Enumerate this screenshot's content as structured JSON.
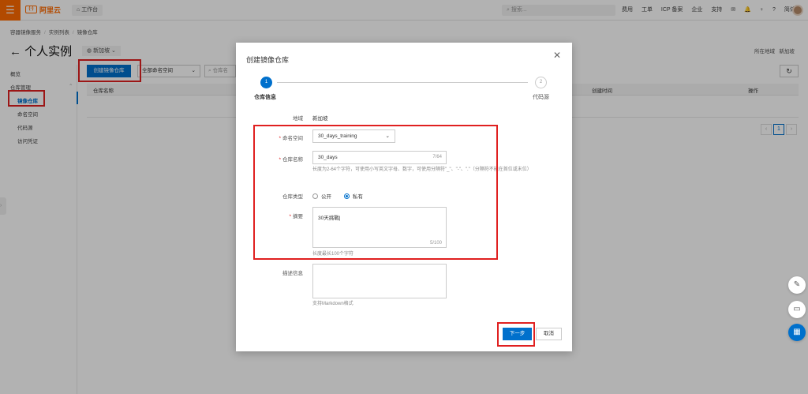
{
  "topbar": {
    "logo": "阿里云",
    "logo_mark": "(-)",
    "workbench": "工作台",
    "search_placeholder": "搜索...",
    "links": [
      "费用",
      "工单",
      "ICP 备案",
      "企业",
      "支持"
    ],
    "language": "简体"
  },
  "breadcrumb": [
    "容器镜像服务",
    "实例列表",
    "镜像仓库"
  ],
  "page": {
    "title": "← 个人实例",
    "region": "新加坡",
    "right_links": [
      "所在地域",
      "新加坡"
    ]
  },
  "sidebar": {
    "items": [
      {
        "label": "概览"
      },
      {
        "label": "仓库管理"
      },
      {
        "label": "镜像仓库"
      },
      {
        "label": "命名空间"
      },
      {
        "label": "代码源"
      },
      {
        "label": "访问凭证"
      }
    ]
  },
  "list": {
    "create_button": "创建镜像仓库",
    "namespace_select": "全部命名空间",
    "search_placeholder": "仓库名",
    "columns": [
      "仓库名称",
      "创建时间",
      "操作"
    ],
    "pager_current": "1"
  },
  "dialog": {
    "title": "创建镜像仓库",
    "close": "✕",
    "steps": [
      {
        "number": "1",
        "label": "仓库信息"
      },
      {
        "number": "2",
        "label": "代码源"
      }
    ],
    "region_label": "地域",
    "region_value": "新加坡",
    "namespace_label": "命名空间",
    "namespace_value": "30_days_training",
    "repo_name_label": "仓库名称",
    "repo_name_value": "30_days",
    "repo_name_counter": "7/64",
    "repo_name_hint": "长度为2-64个字符，可使用小写英文字母、数字，可使用分隔符\"_\"、\"-\"、\".\"（分隔符不能在首位或末位）",
    "repo_type_label": "仓库类型",
    "repo_type_options": [
      "公开",
      "私有"
    ],
    "repo_type_selected": "私有",
    "summary_label": "摘要",
    "summary_value": "30天挑戰",
    "summary_counter": "5/100",
    "summary_hint": "长度最长100个字符",
    "description_label": "描述信息",
    "description_hint": "支持Markdown格式",
    "next_button": "下一步",
    "cancel_button": "取消"
  },
  "colors": {
    "brand": "#ff6a00",
    "primary": "#0070cc",
    "callout": "#e02020"
  }
}
